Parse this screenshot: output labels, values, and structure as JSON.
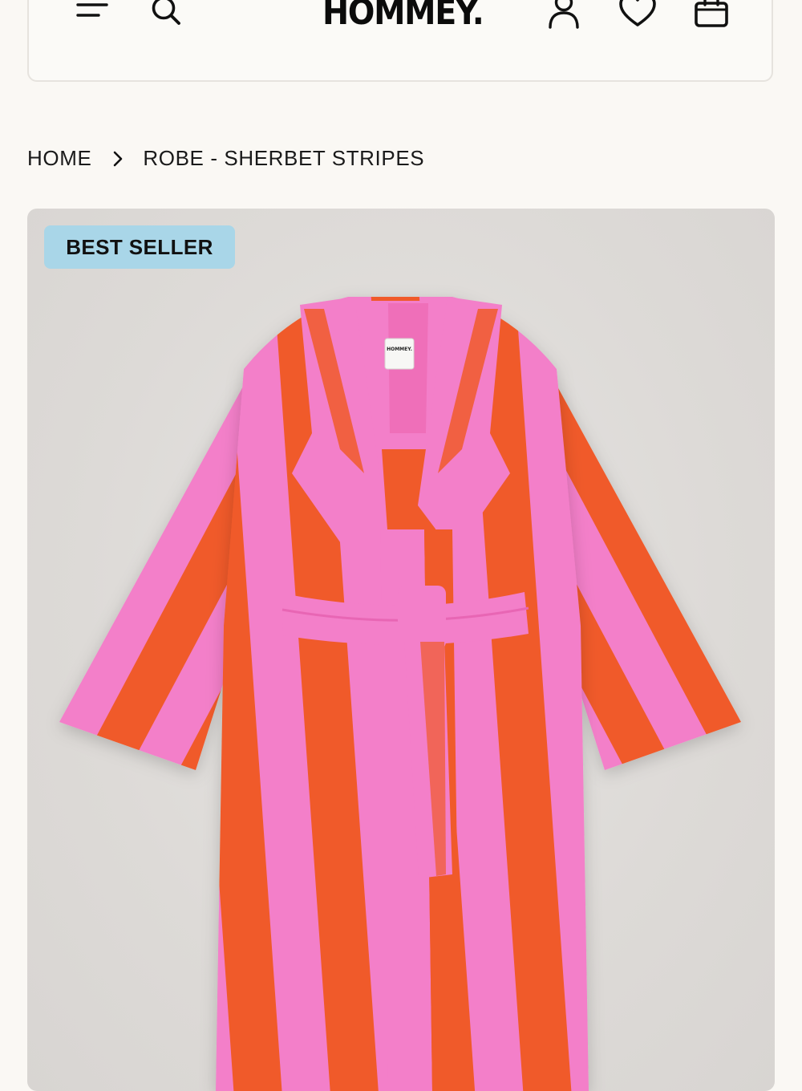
{
  "header": {
    "brand": "HOMMEY.",
    "icons": [
      "menu-icon",
      "search-icon",
      "account-icon",
      "wishlist-heart-icon",
      "cart-bag-icon"
    ]
  },
  "breadcrumb": {
    "home": "HOME",
    "current": "ROBE - SHERBET STRIPES"
  },
  "product": {
    "badge": "BEST SELLER",
    "label_text": "HOMMEY.",
    "colors": {
      "pink": "#f37fc9",
      "orange": "#f05a2a",
      "badge_bg": "#a9d6e8",
      "image_bg": "#dedbd8"
    }
  }
}
